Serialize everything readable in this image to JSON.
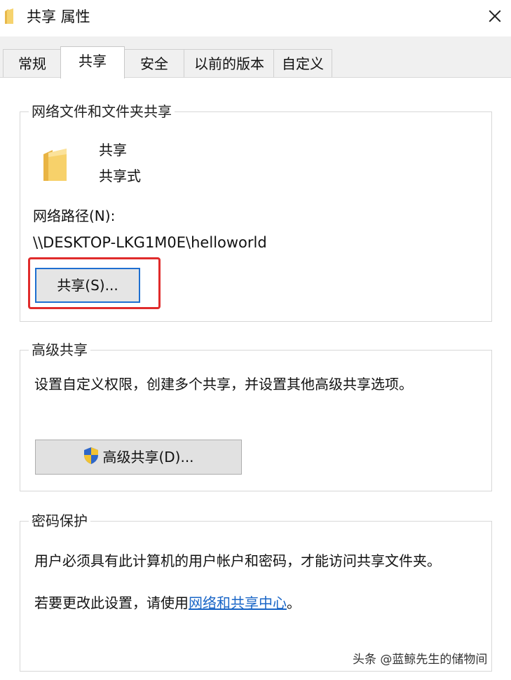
{
  "window": {
    "title": "共享 属性",
    "close_icon": "close-icon"
  },
  "tabs": [
    {
      "label": "常规"
    },
    {
      "label": "共享",
      "active": true
    },
    {
      "label": "安全"
    },
    {
      "label": "以前的版本"
    },
    {
      "label": "自定义"
    }
  ],
  "network_sharing": {
    "group_title": "网络文件和文件夹共享",
    "folder_name": "共享",
    "folder_status": "共享式",
    "path_label": "网络路径(N):",
    "path_value": "\\\\DESKTOP-LKG1M0E\\helloworld",
    "share_button": "共享(S)..."
  },
  "advanced_sharing": {
    "group_title": "高级共享",
    "description": "设置自定义权限，创建多个共享，并设置其他高级共享选项。",
    "button": "高级共享(D)..."
  },
  "password_protection": {
    "group_title": "密码保护",
    "description": "用户必须具有此计算机的用户帐户和密码，才能访问共享文件夹。",
    "change_prefix": "若要更改此设置，请使用",
    "change_link": "网络和共享中心",
    "change_suffix": "。"
  },
  "watermark": "头条 @蓝鲸先生的储物间",
  "colors": {
    "accent": "#1e6fd0",
    "highlight": "#e02b2b",
    "link": "#1a66c7",
    "folder": "#f3c85a"
  }
}
